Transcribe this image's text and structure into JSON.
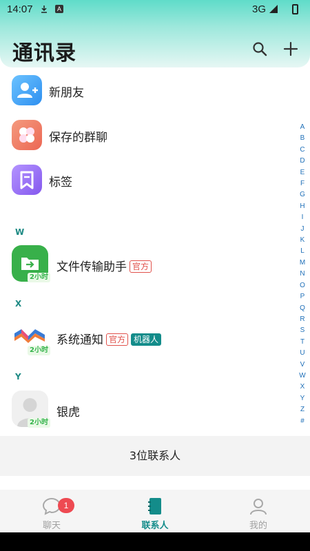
{
  "status_bar": {
    "time": "14:07",
    "network": "3G"
  },
  "header": {
    "title": "通讯录",
    "search_icon": "search-icon",
    "add_icon": "plus-icon"
  },
  "function_items": [
    {
      "label": "新朋友",
      "icon": "add-user-icon",
      "color": "#2e8ff0"
    },
    {
      "label": "保存的群聊",
      "icon": "group-chat-icon",
      "color": "#ec6754"
    },
    {
      "label": "标签",
      "icon": "tag-icon",
      "color": "#8458ee"
    }
  ],
  "sections": [
    {
      "letter": "W",
      "contacts": [
        {
          "name": "文件传输助手",
          "time_badge": "2小时",
          "tags": [
            "官方"
          ]
        }
      ]
    },
    {
      "letter": "X",
      "contacts": [
        {
          "name": "系统通知",
          "time_badge": "2小时",
          "tags": [
            "官方",
            "机器人"
          ]
        }
      ]
    },
    {
      "letter": "Y",
      "contacts": [
        {
          "name": "银虎",
          "time_badge": "2小时",
          "tags": []
        }
      ]
    }
  ],
  "alpha_index": [
    "A",
    "B",
    "C",
    "D",
    "E",
    "F",
    "G",
    "H",
    "I",
    "J",
    "K",
    "L",
    "M",
    "N",
    "O",
    "P",
    "Q",
    "R",
    "S",
    "T",
    "U",
    "V",
    "W",
    "X",
    "Y",
    "Z",
    "#"
  ],
  "contact_count": "3位联系人",
  "tabs": [
    {
      "label": "聊天",
      "icon": "chat-icon",
      "badge": "1",
      "active": false
    },
    {
      "label": "联系人",
      "icon": "contacts-book-icon",
      "active": true
    },
    {
      "label": "我的",
      "icon": "profile-icon",
      "active": false
    }
  ],
  "colors": {
    "accent": "#138c8a",
    "badge_red": "#ee4a52",
    "official_tag": "#e0504a",
    "time_badge_green": "#33b34a"
  }
}
